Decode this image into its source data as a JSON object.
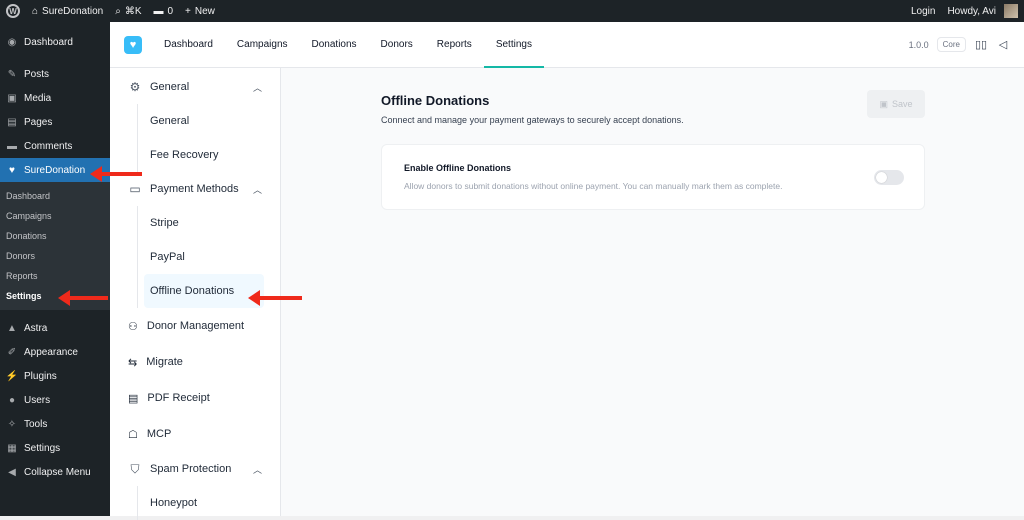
{
  "adminbar": {
    "site_name": "SureDonation",
    "search_shortcut": "⌘K",
    "comments_count": "0",
    "new_label": "New",
    "login_label": "Login",
    "howdy": "Howdy, Avi"
  },
  "sidebar": {
    "dashboard": "Dashboard",
    "posts": "Posts",
    "media": "Media",
    "pages": "Pages",
    "comments": "Comments",
    "suredonation": "SureDonation",
    "submenu": [
      "Dashboard",
      "Campaigns",
      "Donations",
      "Donors",
      "Reports",
      "Settings"
    ],
    "astra": "Astra",
    "appearance": "Appearance",
    "plugins": "Plugins",
    "users": "Users",
    "tools": "Tools",
    "settings": "Settings",
    "collapse": "Collapse Menu"
  },
  "topnav": {
    "tabs": [
      "Dashboard",
      "Campaigns",
      "Donations",
      "Donors",
      "Reports",
      "Settings"
    ],
    "version": "1.0.0",
    "badge": "Core"
  },
  "settings_nav": {
    "general": "General",
    "general_children": [
      "General",
      "Fee Recovery"
    ],
    "payment_methods": "Payment Methods",
    "payment_children": [
      "Stripe",
      "PayPal",
      "Offline Donations"
    ],
    "donor_management": "Donor Management",
    "migrate": "Migrate",
    "pdf_receipt": "PDF Receipt",
    "mcp": "MCP",
    "spam_protection": "Spam Protection",
    "spam_children": [
      "Honeypot"
    ]
  },
  "main": {
    "title": "Offline Donations",
    "description": "Connect and manage your payment gateways to securely accept donations.",
    "save_label": "Save",
    "card_title": "Enable Offline Donations",
    "card_desc": "Allow donors to submit donations without online payment. You can manually mark them as complete.",
    "toggle_enabled": false
  },
  "colors": {
    "accent": "#2271b1",
    "teal": "#14b8a6",
    "annotation_arrow": "#ef2a1b"
  }
}
